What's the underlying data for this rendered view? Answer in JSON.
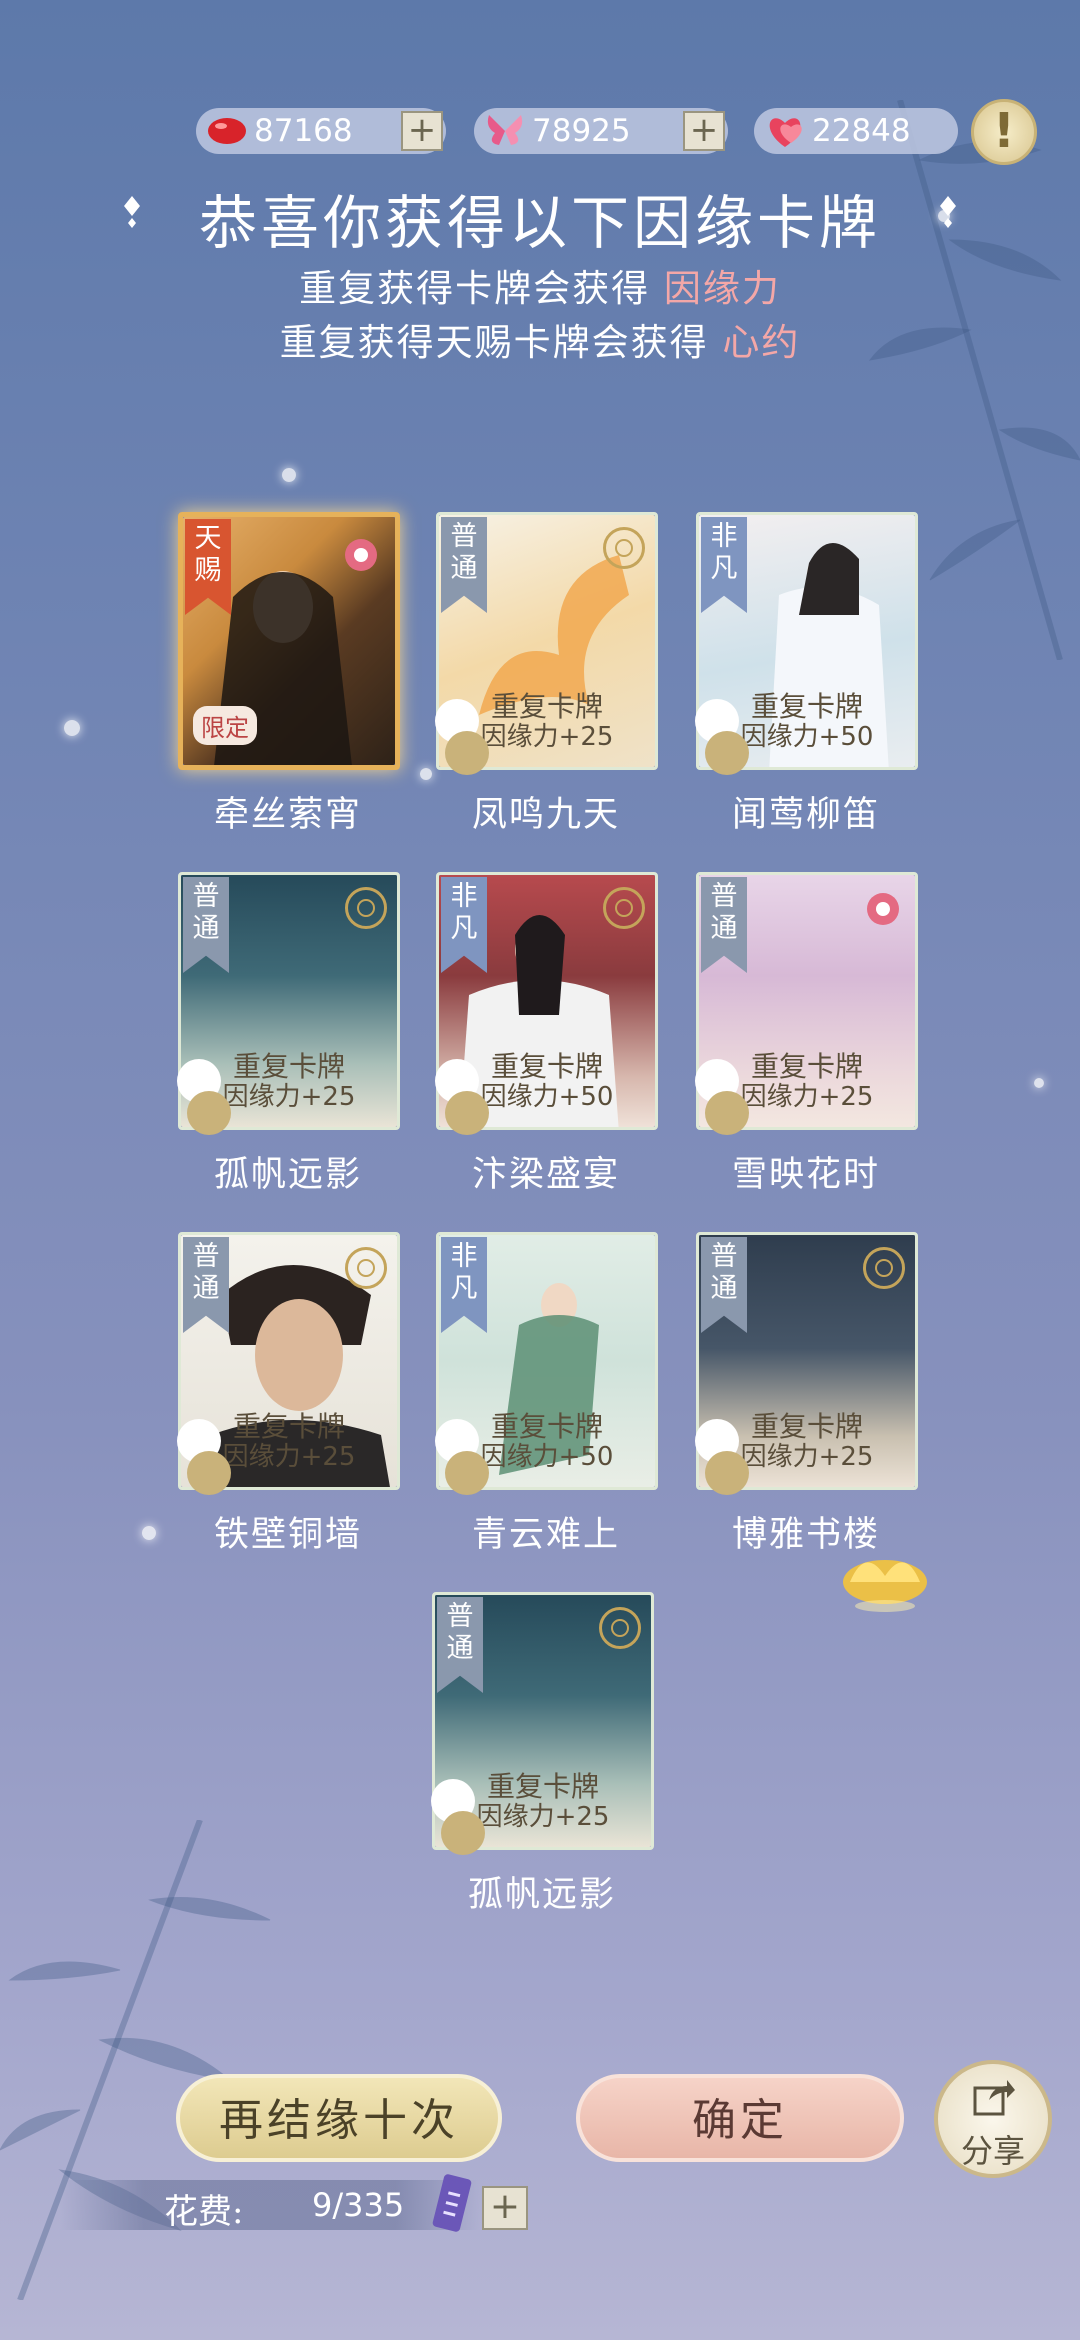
{
  "currencies": [
    {
      "icon": "red-bean-icon",
      "amount": "87168",
      "plus": "+"
    },
    {
      "icon": "butterfly-icon",
      "amount": "78925",
      "plus": "+"
    },
    {
      "icon": "heart-icon",
      "amount": "22848",
      "plus": "+"
    }
  ],
  "alert_label": "!",
  "header": {
    "title": "恭喜你获得以下因缘卡牌",
    "line1_prefix": "重复获得卡牌会获得 ",
    "line1_highlight": "因缘力",
    "line2_prefix": "重复获得天赐卡牌会获得 ",
    "line2_highlight": "心约"
  },
  "cards": [
    {
      "tier": "天赐",
      "name": "牵丝萦宵",
      "limited": "限定"
    },
    {
      "tier": "普通",
      "name": "凤鸣九天",
      "repeat": "重复卡牌",
      "bonus": "因缘力+25"
    },
    {
      "tier": "非凡",
      "name": "闻莺柳笛",
      "repeat": "重复卡牌",
      "bonus": "因缘力+50"
    },
    {
      "tier": "普通",
      "name": "孤帆远影",
      "repeat": "重复卡牌",
      "bonus": "因缘力+25"
    },
    {
      "tier": "非凡",
      "name": "汴梁盛宴",
      "repeat": "重复卡牌",
      "bonus": "因缘力+50"
    },
    {
      "tier": "普通",
      "name": "雪映花时",
      "repeat": "重复卡牌",
      "bonus": "因缘力+25"
    },
    {
      "tier": "普通",
      "name": "铁壁铜墙",
      "repeat": "重复卡牌",
      "bonus": "因缘力+25"
    },
    {
      "tier": "非凡",
      "name": "青云难上",
      "repeat": "重复卡牌",
      "bonus": "因缘力+50"
    },
    {
      "tier": "普通",
      "name": "博雅书楼",
      "repeat": "重复卡牌",
      "bonus": "因缘力+25"
    },
    {
      "tier": "普通",
      "name": "孤帆远影",
      "repeat": "重复卡牌",
      "bonus": "因缘力+25"
    }
  ],
  "buttons": {
    "again": "再结缘十次",
    "confirm": "确定",
    "share": "分享"
  },
  "cost": {
    "label": "花费:",
    "value": "9/335",
    "plus": "+"
  },
  "colors": {
    "highlight": "#f4a7a7",
    "gold_border": "#e6b25a",
    "card_border": "#dfe9d6"
  }
}
